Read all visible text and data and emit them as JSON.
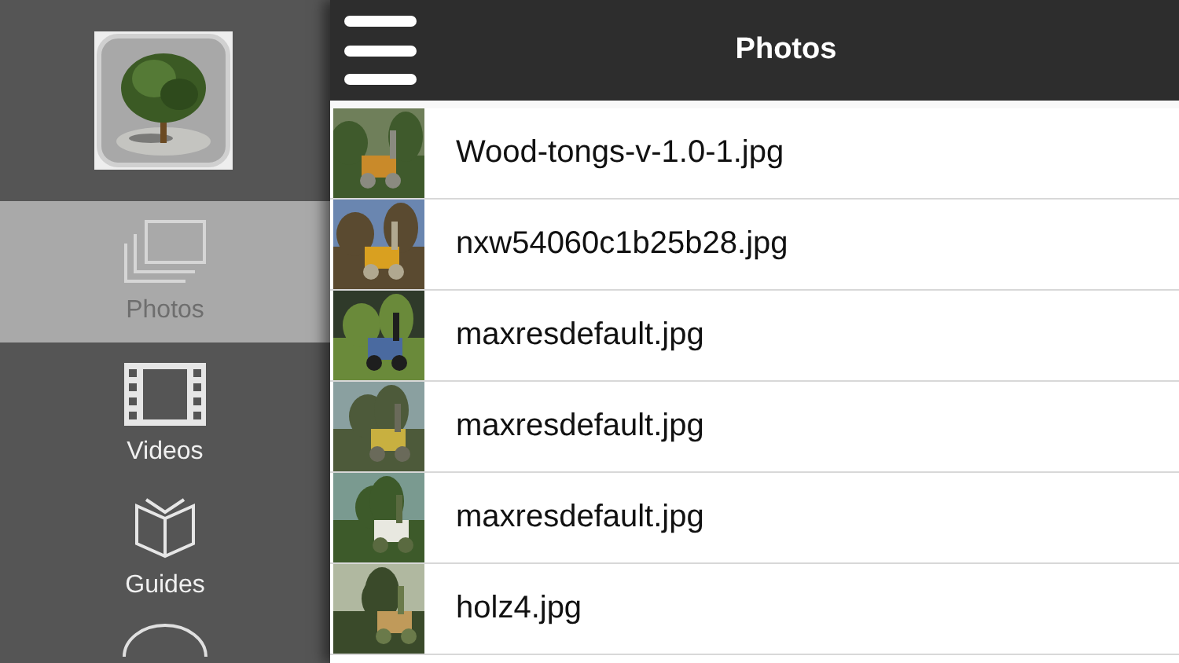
{
  "sidebar": {
    "items": [
      {
        "kind": "photos",
        "label": "Photos",
        "selected": true
      },
      {
        "kind": "videos",
        "label": "Videos",
        "selected": false
      },
      {
        "kind": "guides",
        "label": "Guides",
        "selected": false
      }
    ]
  },
  "header": {
    "title": "Photos"
  },
  "photos": [
    {
      "name": "Wood-tongs-v-1.0-1.jpg"
    },
    {
      "name": "nxw54060c1b25b28.jpg"
    },
    {
      "name": "maxresdefault.jpg"
    },
    {
      "name": "maxresdefault.jpg"
    },
    {
      "name": "maxresdefault.jpg"
    },
    {
      "name": "holz4.jpg"
    }
  ]
}
